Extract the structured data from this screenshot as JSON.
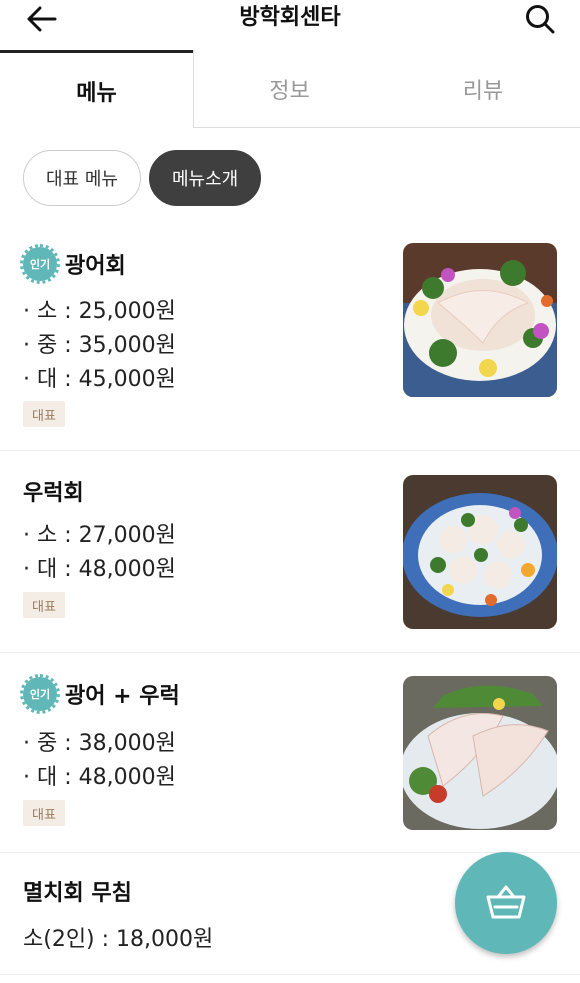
{
  "header": {
    "title": "방학회센타",
    "back_icon": "arrow-left-icon",
    "search_icon": "search-icon"
  },
  "tabs": [
    {
      "label": "메뉴",
      "active": true
    },
    {
      "label": "정보",
      "active": false
    },
    {
      "label": "리뷰",
      "active": false
    }
  ],
  "chips": [
    {
      "label": "대표 메뉴",
      "selected": false
    },
    {
      "label": "메뉴소개",
      "selected": true
    }
  ],
  "popular_badge": "인기",
  "menu": [
    {
      "name": "광어회",
      "popular": true,
      "prices": [
        "· 소 : 25,000원",
        "· 중 : 35,000원",
        "· 대 : 45,000원"
      ],
      "tag": "대표",
      "image": "halibut-sashimi-plate"
    },
    {
      "name": "우럭회",
      "popular": false,
      "prices": [
        "· 소 : 27,000원",
        "· 대 : 48,000원"
      ],
      "tag": "대표",
      "image": "rockfish-sashimi-plate"
    },
    {
      "name": "광어 + 우럭",
      "popular": true,
      "prices": [
        "· 중 : 38,000원",
        "· 대 : 48,000원"
      ],
      "tag": "대표",
      "image": "mixed-sashimi-plate"
    },
    {
      "name": "멸치회 무침",
      "popular": false,
      "prices": [
        "소(2인) : 18,000원"
      ],
      "tag": null,
      "image": null
    }
  ],
  "cart_icon": "basket-icon",
  "colors": {
    "accent": "#5fb8b7",
    "chip_selected": "#3f3f3f",
    "tag_bg": "#f3ede6",
    "tag_text": "#9a7b5c"
  }
}
